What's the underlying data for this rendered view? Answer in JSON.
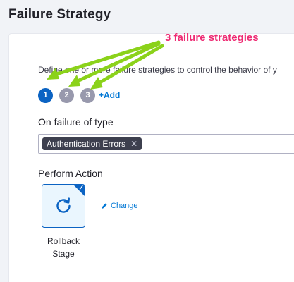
{
  "page": {
    "title": "Failure Strategy"
  },
  "description": "Define one or more failure strategies to control the behavior of y",
  "strategies": {
    "steps": [
      "1",
      "2",
      "3"
    ],
    "active_index": 0,
    "add_label": "+Add"
  },
  "failure_type": {
    "label": "On failure of type",
    "selected_tags": [
      "Authentication Errors"
    ],
    "remove_icon": "close-icon"
  },
  "perform_action": {
    "label": "Perform Action",
    "selected_action": {
      "label_line1": "Rollback",
      "label_line2": "Stage",
      "icon": "rollback-icon",
      "checked": true
    },
    "change_label": "Change",
    "change_icon": "pencil-icon"
  },
  "annotation": {
    "text": "3 failure strategies",
    "color": "#ee2b73",
    "arrow_color": "#8bd21a"
  },
  "colors": {
    "accent": "#0b63c3",
    "link": "#0278d5",
    "step_inactive": "#9899ad",
    "tag_bg": "#3d3f4e"
  }
}
